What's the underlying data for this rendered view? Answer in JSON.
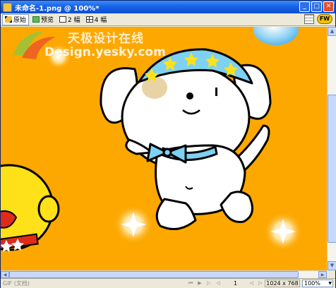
{
  "window": {
    "title": "未命名-1.png @ 100%*",
    "min_glyph": "_",
    "max_glyph": "□",
    "close_glyph": "✕"
  },
  "toolbar": {
    "tabs": [
      {
        "label": "原始",
        "icon": "pencil-icon"
      },
      {
        "label": "预览",
        "icon": "preview-icon"
      },
      {
        "label": "2 幅",
        "icon": "two-up-icon"
      },
      {
        "label": "4 幅",
        "icon": "four-up-icon"
      }
    ],
    "logo_text": "FW"
  },
  "canvas": {
    "background_color": "#fda800",
    "watermark_cn": "天极设计在线",
    "watermark_en": "Design.yesky.com"
  },
  "statusbar": {
    "document_type": "GIF (文档)",
    "page_number": "1",
    "dimensions": "1024 x 768",
    "zoom": "100%"
  },
  "scrollbars": {
    "up_glyph": "▲",
    "down_glyph": "▼",
    "left_glyph": "◀",
    "right_glyph": "▶"
  }
}
